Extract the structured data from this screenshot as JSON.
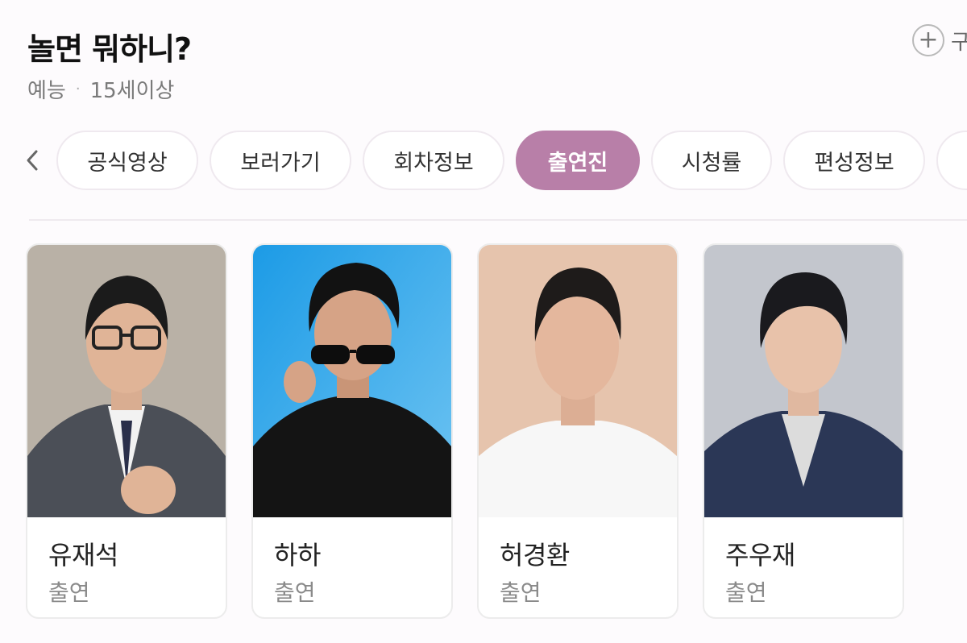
{
  "header": {
    "title": "놀면 뭐하니?",
    "genre": "예능",
    "rating": "15세이상",
    "add_label": "구"
  },
  "tabs": [
    {
      "label": "공식영상",
      "active": false
    },
    {
      "label": "보러가기",
      "active": false
    },
    {
      "label": "회차정보",
      "active": false
    },
    {
      "label": "출연진",
      "active": true
    },
    {
      "label": "시청률",
      "active": false
    },
    {
      "label": "편성정보",
      "active": false
    }
  ],
  "cast": [
    {
      "name": "유재석",
      "role": "출연"
    },
    {
      "name": "하하",
      "role": "출연"
    },
    {
      "name": "허경환",
      "role": "출연"
    },
    {
      "name": "주우재",
      "role": "출연"
    }
  ],
  "colors": {
    "accent": "#b87fa8",
    "background": "#fdfbfd"
  }
}
